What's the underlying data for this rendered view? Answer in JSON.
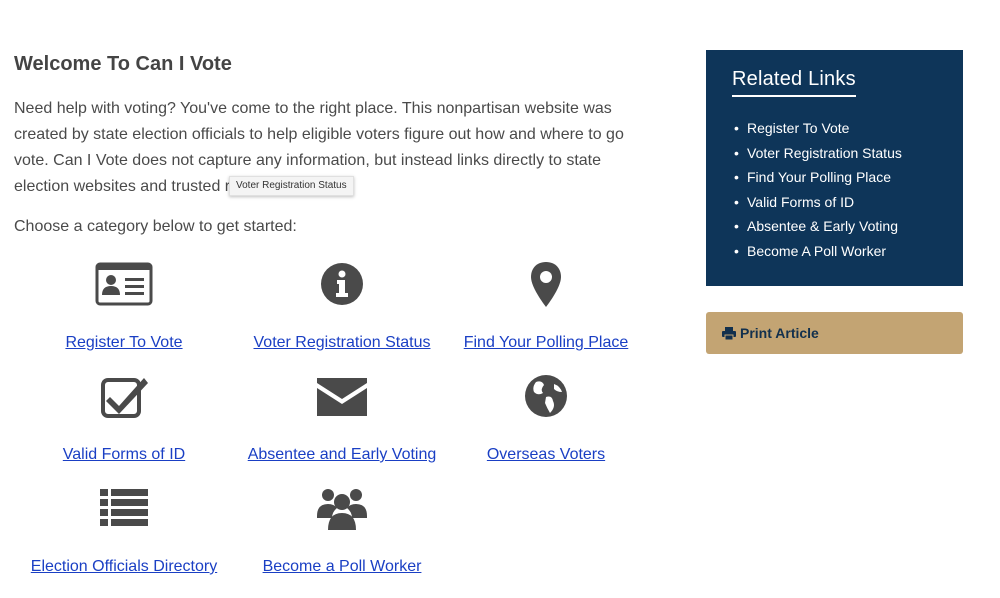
{
  "main": {
    "title": "Welcome To Can I Vote",
    "intro_lines": [
      "Need help with voting? You've come to the right place. This nonpartisan website was",
      "created by state election officials to help eligible voters figure out how and where to go",
      "vote. Can I Vote does not capture any information, but instead links directly to state",
      "election websites and trusted r"
    ],
    "choose_text": "Choose a category below to get started:",
    "categories": [
      {
        "label": "Register To Vote",
        "icon": "id-card-icon"
      },
      {
        "label": "Voter Registration Status",
        "icon": "info-circle-icon"
      },
      {
        "label": "Find Your Polling Place",
        "icon": "map-marker-icon"
      },
      {
        "label": "Valid Forms of ID",
        "icon": "checkbox-icon"
      },
      {
        "label": "Absentee and Early Voting",
        "icon": "envelope-icon"
      },
      {
        "label": "Overseas Voters",
        "icon": "globe-icon"
      },
      {
        "label": "Election Officials Directory",
        "icon": "list-icon"
      },
      {
        "label": "Become a Poll Worker",
        "icon": "users-icon"
      }
    ]
  },
  "tooltip": {
    "text": "Voter Registration Status"
  },
  "sidebar": {
    "title": "Related Links",
    "items": [
      "Register To Vote",
      "Voter Registration Status",
      "Find Your Polling Place",
      "Valid Forms of ID",
      "Absentee & Early Voting",
      "Become A Poll Worker"
    ]
  },
  "print": {
    "label": "Print Article",
    "icon": "printer-icon"
  },
  "colors": {
    "sidebar_bg": "#0e3559",
    "print_bg": "#c3a473",
    "link": "#1a3fc4",
    "icon": "#4a4a4a"
  }
}
